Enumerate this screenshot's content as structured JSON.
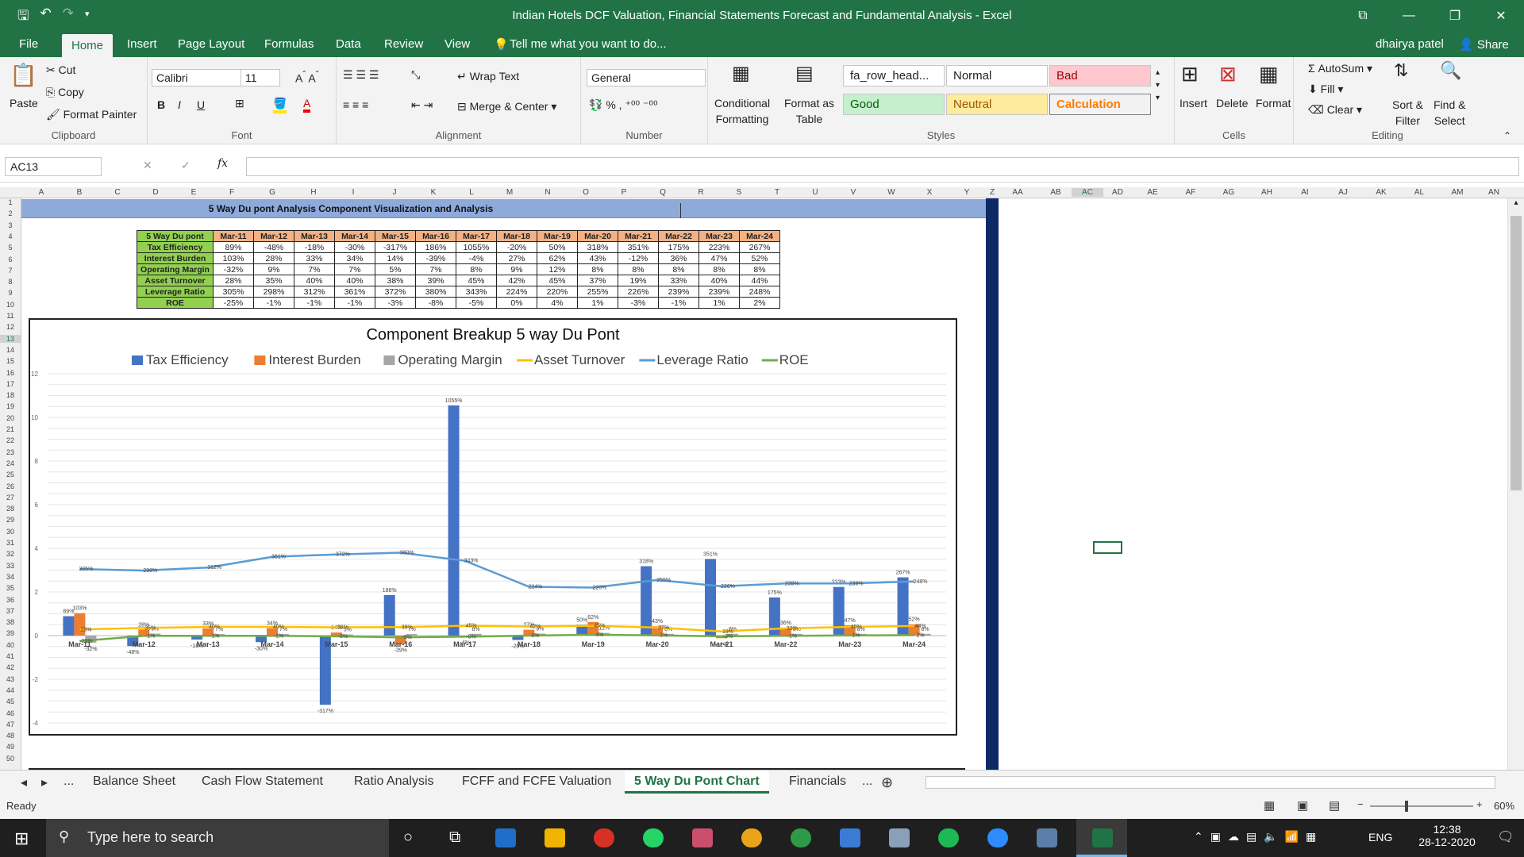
{
  "window": {
    "title": "Indian Hotels DCF Valuation, Financial Statements Forecast and Fundamental Analysis  -  Excel",
    "user": "dhairya patel",
    "share": "Share"
  },
  "menu": [
    "File",
    "Home",
    "Insert",
    "Page Layout",
    "Formulas",
    "Data",
    "Review",
    "View"
  ],
  "tell_me": "Tell me what you want to do...",
  "clipboard": {
    "paste": "Paste",
    "cut": "Cut",
    "copy": "Copy",
    "format_painter": "Format Painter",
    "label": "Clipboard"
  },
  "font": {
    "name": "Calibri",
    "size": "11",
    "label": "Font"
  },
  "alignment": {
    "wrap": "Wrap Text",
    "merge": "Merge & Center",
    "label": "Alignment"
  },
  "number": {
    "format": "General",
    "label": "Number"
  },
  "styles": {
    "cond1": "Conditional",
    "cond2": "Formatting",
    "fmt1": "Format as",
    "fmt2": "Table",
    "cell1": "fa_row_head...",
    "normal": "Normal",
    "bad": "Bad",
    "good": "Good",
    "neutral": "Neutral",
    "calculation": "Calculation",
    "label": "Styles"
  },
  "cells": {
    "insert": "Insert",
    "delete": "Delete",
    "format": "Format",
    "label": "Cells"
  },
  "editing": {
    "autosum": "AutoSum",
    "fill": "Fill",
    "clear": "Clear",
    "sort1": "Sort &",
    "sort2": "Filter",
    "find1": "Find &",
    "find2": "Select",
    "label": "Editing"
  },
  "name_box": "AC13",
  "columns": [
    "A",
    "B",
    "C",
    "D",
    "E",
    "F",
    "G",
    "H",
    "I",
    "J",
    "K",
    "L",
    "M",
    "N",
    "O",
    "P",
    "Q",
    "R",
    "S",
    "T",
    "U",
    "V",
    "W",
    "X",
    "Y",
    "Z",
    "AA",
    "AB",
    "AC",
    "AD",
    "AE",
    "AF",
    "AG",
    "AH",
    "AI",
    "AJ",
    "AK",
    "AL",
    "AM",
    "AN"
  ],
  "banner_title": "5 Way Du pont Analysis Component Visualization and Analysis",
  "table": {
    "header": [
      "5 Way Du pont",
      "Mar-11",
      "Mar-12",
      "Mar-13",
      "Mar-14",
      "Mar-15",
      "Mar-16",
      "Mar-17",
      "Mar-18",
      "Mar-19",
      "Mar-20",
      "Mar-21",
      "Mar-22",
      "Mar-23",
      "Mar-24"
    ],
    "rows": [
      {
        "label": "Tax Efficiency",
        "values": [
          "89%",
          "-48%",
          "-18%",
          "-30%",
          "-317%",
          "186%",
          "1055%",
          "-20%",
          "50%",
          "318%",
          "351%",
          "175%",
          "223%",
          "267%"
        ]
      },
      {
        "label": "Interest Burden",
        "values": [
          "103%",
          "28%",
          "33%",
          "34%",
          "14%",
          "-39%",
          "-4%",
          "27%",
          "62%",
          "43%",
          "-12%",
          "36%",
          "47%",
          "52%"
        ]
      },
      {
        "label": "Operating Margin",
        "values": [
          "-32%",
          "9%",
          "7%",
          "7%",
          "5%",
          "7%",
          "8%",
          "9%",
          "12%",
          "8%",
          "8%",
          "8%",
          "8%",
          "8%"
        ]
      },
      {
        "label": "Asset Turnover",
        "values": [
          "28%",
          "35%",
          "40%",
          "40%",
          "38%",
          "39%",
          "45%",
          "42%",
          "45%",
          "37%",
          "19%",
          "33%",
          "40%",
          "44%"
        ]
      },
      {
        "label": "Leverage Ratio",
        "values": [
          "305%",
          "298%",
          "312%",
          "361%",
          "372%",
          "380%",
          "343%",
          "224%",
          "220%",
          "255%",
          "226%",
          "239%",
          "239%",
          "248%"
        ]
      },
      {
        "label": "ROE",
        "values": [
          "-25%",
          "-1%",
          "-1%",
          "-1%",
          "-3%",
          "-8%",
          "-5%",
          "0%",
          "4%",
          "1%",
          "-3%",
          "-1%",
          "1%",
          "2%"
        ]
      }
    ]
  },
  "chart_data": {
    "type": "bar",
    "title": "Component Breakup 5 way Du Pont",
    "categories": [
      "Mar-11",
      "Mar-12",
      "Mar-13",
      "Mar-14",
      "Mar-15",
      "Mar-16",
      "Mar-17",
      "Mar-18",
      "Mar-19",
      "Mar-20",
      "Mar-21",
      "Mar-22",
      "Mar-23",
      "Mar-24"
    ],
    "ylim": [
      -4,
      12
    ],
    "yticks": [
      -4,
      -2,
      0,
      2,
      4,
      6,
      8,
      10,
      12
    ],
    "legend_position": "top",
    "series": [
      {
        "name": "Tax Efficiency",
        "kind": "bar",
        "color": "#4472c4",
        "values": [
          0.89,
          -0.48,
          -0.18,
          -0.3,
          -3.17,
          1.86,
          10.55,
          -0.2,
          0.5,
          3.18,
          3.51,
          1.75,
          2.23,
          2.67
        ],
        "labels": [
          "89%",
          "-48%",
          "-18%",
          "-30%",
          "-317%",
          "186%",
          "1055%",
          "-20%",
          "50%",
          "318%",
          "351%",
          "175%",
          "223%",
          "267%"
        ]
      },
      {
        "name": "Interest Burden",
        "kind": "bar",
        "color": "#ed7d31",
        "values": [
          1.03,
          0.28,
          0.33,
          0.34,
          0.14,
          -0.39,
          -0.04,
          0.27,
          0.62,
          0.43,
          -0.12,
          0.36,
          0.47,
          0.52
        ],
        "labels": [
          "103%",
          "28%",
          "33%",
          "34%",
          "14%",
          "-39%",
          "-4%",
          "27%",
          "62%",
          "43%",
          "-12%",
          "36%",
          "47%",
          "52%"
        ]
      },
      {
        "name": "Operating Margin",
        "kind": "bar",
        "color": "#a5a5a5",
        "values": [
          -0.32,
          0.09,
          0.07,
          0.07,
          0.05,
          0.07,
          0.08,
          0.09,
          0.12,
          0.08,
          0.08,
          0.08,
          0.08,
          0.08
        ],
        "labels": [
          "-32%",
          "9%",
          "7%",
          "7%",
          "5%",
          "7%",
          "8%",
          "9%",
          "12%",
          "8%",
          "8%",
          "8%",
          "8%",
          "8%"
        ]
      },
      {
        "name": "Asset Turnover",
        "kind": "line",
        "color": "#ffc000",
        "values": [
          0.28,
          0.35,
          0.4,
          0.4,
          0.38,
          0.39,
          0.45,
          0.42,
          0.45,
          0.37,
          0.19,
          0.33,
          0.4,
          0.44
        ],
        "labels": [
          "28%",
          "35%",
          "40%",
          "40%",
          "38%",
          "39%",
          "45%",
          "42%",
          "45%",
          "37%",
          "19%",
          "33%",
          "40%",
          "44%"
        ]
      },
      {
        "name": "Leverage Ratio",
        "kind": "line",
        "color": "#5b9bd5",
        "values": [
          3.05,
          2.98,
          3.12,
          3.61,
          3.72,
          3.8,
          3.43,
          2.24,
          2.2,
          2.55,
          2.26,
          2.39,
          2.39,
          2.48
        ],
        "labels": [
          "305%",
          "298%",
          "312%",
          "361%",
          "372%",
          "380%",
          "343%",
          "224%",
          "220%",
          "255%",
          "226%",
          "239%",
          "239%",
          "248%"
        ]
      },
      {
        "name": "ROE",
        "kind": "line",
        "color": "#70ad47",
        "values": [
          -0.25,
          -0.01,
          -0.01,
          -0.01,
          -0.03,
          -0.08,
          -0.05,
          0.0,
          0.04,
          0.01,
          -0.03,
          -0.01,
          0.01,
          0.02
        ],
        "labels": [
          "-25%",
          "-1%",
          "-1%",
          "-1%",
          "-3%",
          "-8%",
          "-5%",
          "0%",
          "4%",
          "1%",
          "-3%",
          "-1%",
          "1%",
          "2%"
        ]
      }
    ]
  },
  "sheet_tabs": [
    "...",
    "Balance Sheet",
    "Cash Flow Statement",
    "Ratio Analysis",
    "FCFF and FCFE Valuation",
    "5 Way Du Pont Chart",
    "Financials",
    "..."
  ],
  "status": {
    "ready": "Ready",
    "zoom": "60%"
  },
  "taskbar": {
    "search": "Type here to search",
    "lang": "ENG",
    "time": "12:38",
    "date": "28-12-2020"
  }
}
